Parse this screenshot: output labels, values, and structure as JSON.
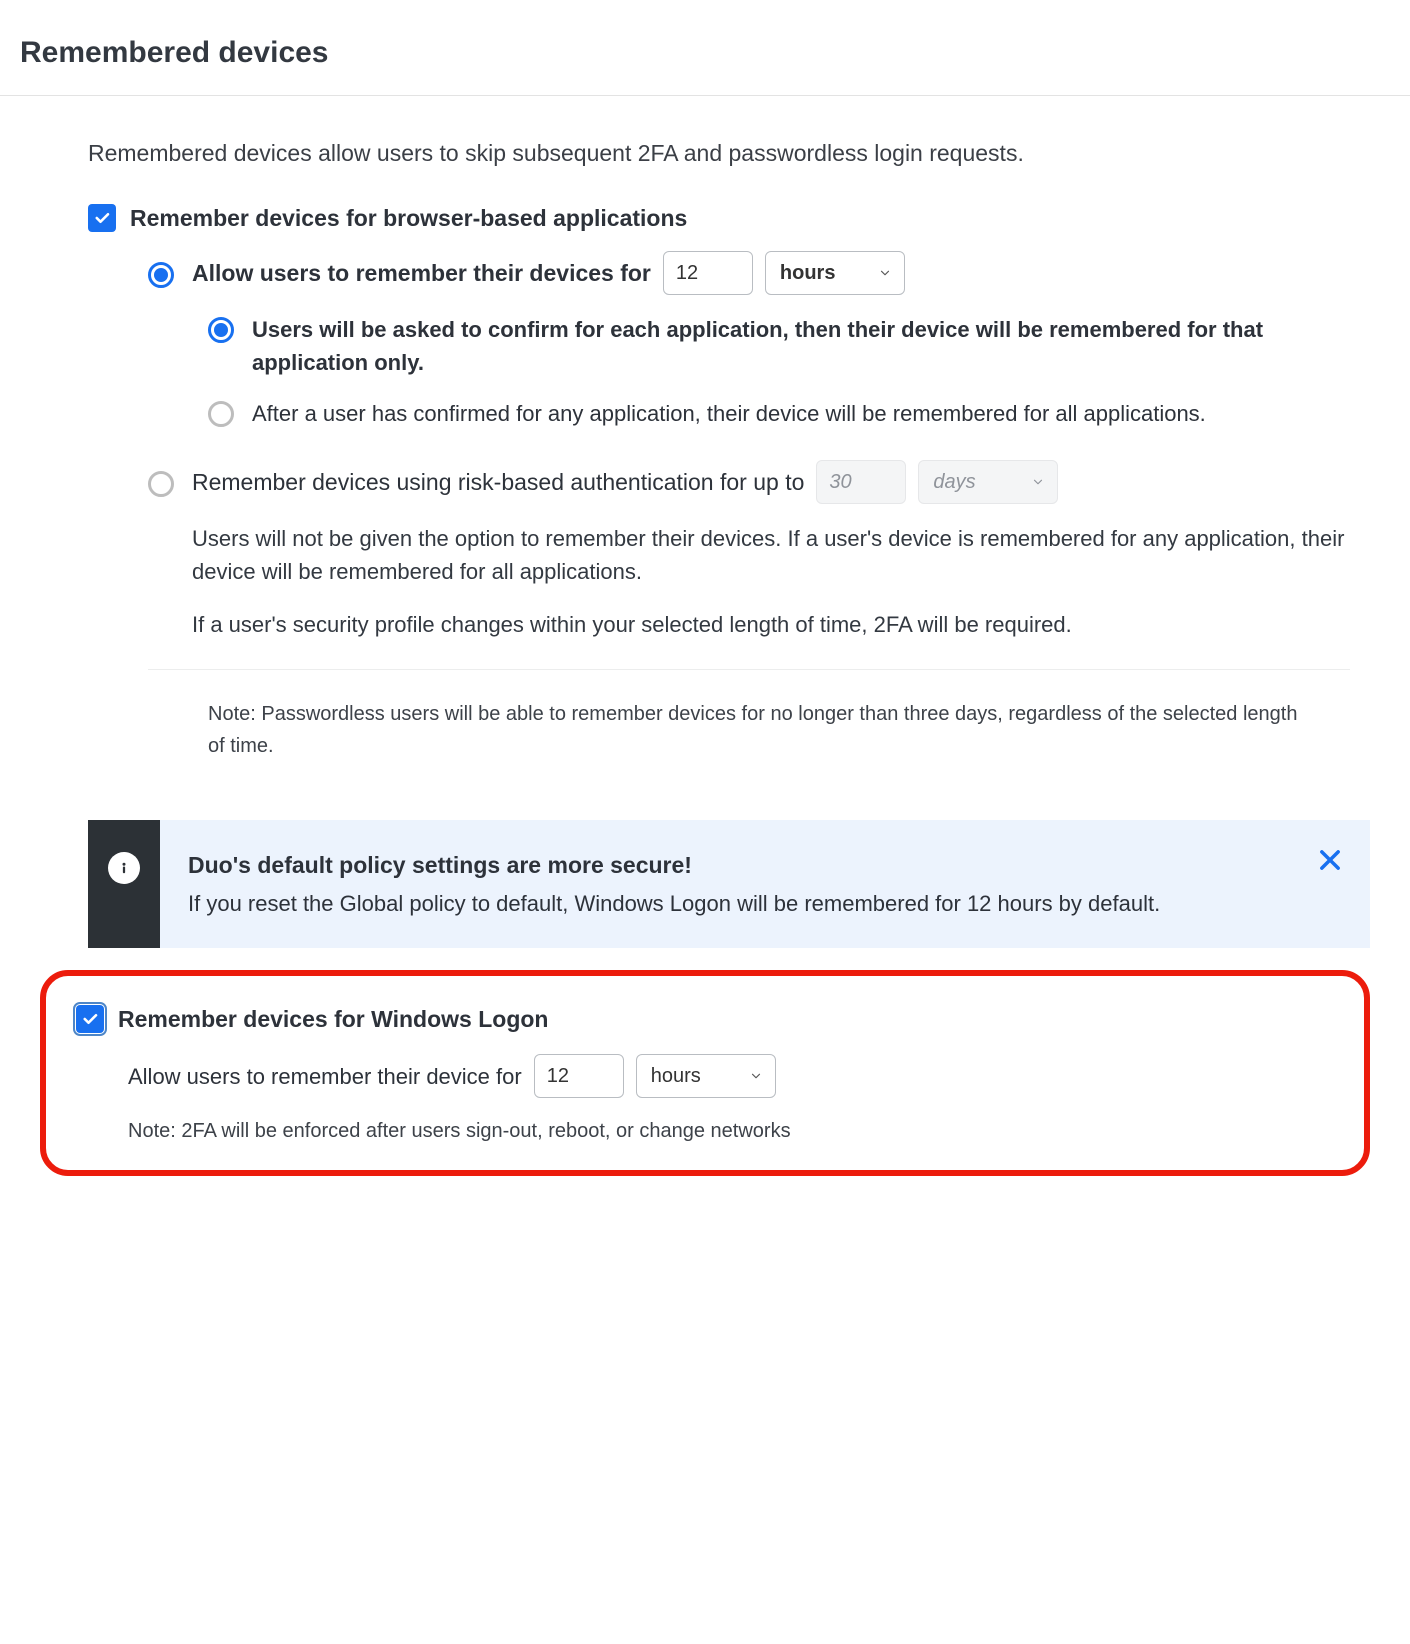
{
  "section_title": "Remembered devices",
  "intro": "Remembered devices allow users to skip subsequent 2FA and passwordless login requests.",
  "browser": {
    "checkbox_label": "Remember devices for browser-based applications",
    "checked": true,
    "option_allow": {
      "label_prefix": "Allow users to remember their devices for",
      "duration_value": "12",
      "duration_unit": "hours",
      "sub_confirm_each": "Users will be asked to confirm for each application, then their device will be remembered for that application only.",
      "sub_confirm_any": "After a user has confirmed for any application, their device will be remembered for all applications."
    },
    "option_risk": {
      "label_prefix": "Remember devices using risk-based authentication for up to",
      "duration_value": "30",
      "duration_unit": "days",
      "desc1": "Users will not be given the option to remember their devices. If a user's device is remembered for any application, their device will be remembered for all applications.",
      "desc2": "If a user's security profile changes within your selected length of time, 2FA will be required."
    }
  },
  "note_passwordless": "Note: Passwordless users will be able to remember devices for no longer than three days, regardless of the selected length of time.",
  "banner": {
    "title": "Duo's default policy settings are more secure!",
    "body": "If you reset the Global policy to default, Windows Logon will be remembered for 12 hours by default."
  },
  "windows": {
    "checkbox_label": "Remember devices for Windows Logon",
    "checked": true,
    "label_prefix": "Allow users to remember their device for",
    "duration_value": "12",
    "duration_unit": "hours",
    "note": "Note: 2FA will be enforced after users sign-out, reboot, or change networks"
  }
}
